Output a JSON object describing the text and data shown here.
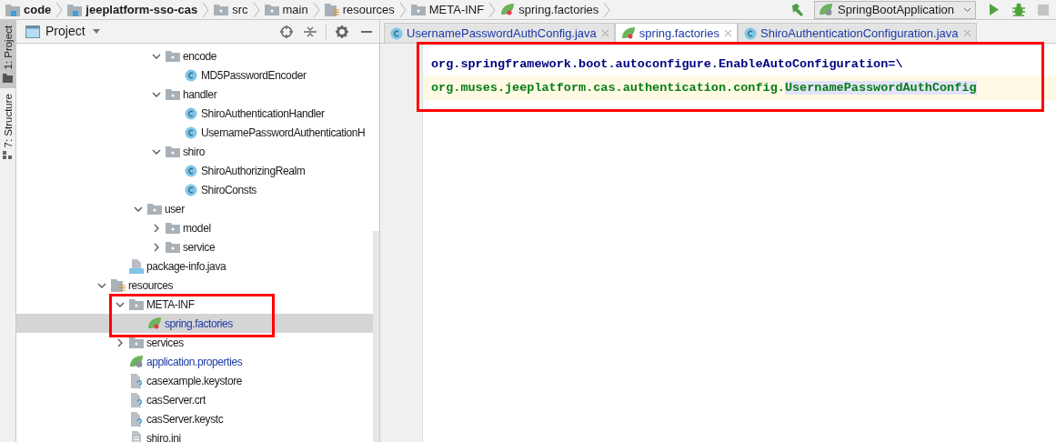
{
  "breadcrumb": [
    {
      "label": "code",
      "kind": "module",
      "bold": true
    },
    {
      "label": "jeeplatform-sso-cas",
      "kind": "module",
      "bold": true
    },
    {
      "label": "src",
      "kind": "folder",
      "bold": false
    },
    {
      "label": "main",
      "kind": "folder",
      "bold": false
    },
    {
      "label": "resources",
      "kind": "resources",
      "bold": false
    },
    {
      "label": "META-INF",
      "kind": "folder",
      "bold": false
    },
    {
      "label": "spring.factories",
      "kind": "spring",
      "bold": false
    }
  ],
  "run_config": {
    "label": "SpringBootApplication"
  },
  "tool_strip": [
    {
      "label": "1: Project",
      "selected": true
    },
    {
      "label": "7: Structure",
      "selected": false
    }
  ],
  "project_panel": {
    "title": "Project",
    "tree": [
      {
        "children": [
          {
            "children": [
              {
                "children": [
                  {
                    "label": "encode",
                    "kind": "folder",
                    "expanded": true,
                    "selected": false,
                    "children": [
                      {
                        "label": "MD5PasswordEncoder",
                        "kind": "class",
                        "selected": false
                      }
                    ]
                  },
                  {
                    "label": "handler",
                    "kind": "folder",
                    "expanded": true,
                    "selected": false,
                    "children": [
                      {
                        "label": "ShiroAuthenticationHandler",
                        "kind": "class",
                        "selected": false
                      },
                      {
                        "label": "UsernamePasswordAuthenticationH",
                        "kind": "class",
                        "selected": false
                      }
                    ]
                  },
                  {
                    "label": "shiro",
                    "kind": "folder",
                    "expanded": true,
                    "selected": false,
                    "children": [
                      {
                        "label": "ShiroAuthorizingRealm",
                        "kind": "class",
                        "selected": false
                      },
                      {
                        "label": "ShiroConsts",
                        "kind": "class",
                        "selected": false
                      }
                    ]
                  }
                ]
              },
              {
                "label": "user",
                "kind": "folder",
                "expanded": true,
                "selected": false,
                "children": [
                  {
                    "label": "model",
                    "kind": "folder",
                    "expanded": false,
                    "selected": false
                  },
                  {
                    "label": "service",
                    "kind": "folder",
                    "expanded": false,
                    "selected": false
                  }
                ]
              }
            ]
          },
          {
            "label": "package-info.java",
            "kind": "java",
            "selected": false
          }
        ]
      },
      {
        "label": "resources",
        "kind": "resources",
        "expanded": true,
        "selected": false,
        "children": [
          {
            "label": "META-INF",
            "kind": "folder",
            "expanded": true,
            "selected": false,
            "children": [
              {
                "label": "spring.factories",
                "kind": "spring",
                "selected": true,
                "color": "#1d3aa6"
              }
            ]
          },
          {
            "label": "services",
            "kind": "folder",
            "expanded": false,
            "selected": false
          },
          {
            "label": "application.properties",
            "kind": "properties",
            "selected": false,
            "color": "#1d3aa6"
          },
          {
            "label": "casexample.keystore",
            "kind": "unknown",
            "selected": false
          },
          {
            "label": "casServer.crt",
            "kind": "unknown",
            "selected": false
          },
          {
            "label": "casServer.keystc",
            "kind": "unknown",
            "selected": false
          },
          {
            "label": "shiro.ini",
            "kind": "ini",
            "selected": false
          }
        ]
      }
    ]
  },
  "editor_tabs": [
    {
      "label": "UsernamePasswordAuthConfig.java",
      "kind": "class",
      "selected": false
    },
    {
      "label": "spring.factories",
      "kind": "spring",
      "selected": true
    },
    {
      "label": "ShiroAuthenticationConfiguration.java",
      "kind": "class",
      "selected": false
    }
  ],
  "code_lines": [
    {
      "current": false,
      "segments": [
        {
          "text": "org.springframework.boot.autoconfigure.EnableAutoConfiguration=\\",
          "kind": "key"
        }
      ]
    },
    {
      "current": true,
      "segments": [
        {
          "text": "org.muses.jeeplatform.cas.authentication.config.",
          "kind": "value"
        },
        {
          "text": "UsernamePasswordAuthConfig",
          "kind": "reference"
        }
      ]
    }
  ]
}
